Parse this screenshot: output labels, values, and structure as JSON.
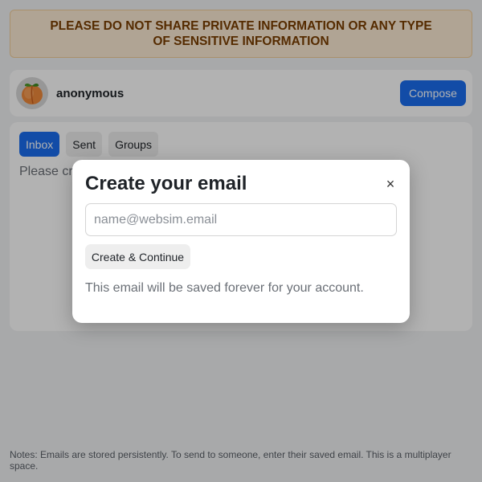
{
  "banner": {
    "text": "PLEASE DO NOT SHARE PRIVATE INFORMATION OR ANY TYPE OF SENSITIVE INFORMATION"
  },
  "profile": {
    "avatar_icon": "peach-icon",
    "username": "anonymous",
    "compose_label": "Compose"
  },
  "tabs": [
    {
      "label": "Inbox",
      "active": true
    },
    {
      "label": "Sent",
      "active": false
    },
    {
      "label": "Groups",
      "active": false
    }
  ],
  "panel": {
    "text": "Please cr"
  },
  "footer": {
    "note": "Notes: Emails are stored persistently. To send to someone, enter their saved email. This is a multiplayer space."
  },
  "modal": {
    "title": "Create your email",
    "close_icon": "close-icon",
    "close_glyph": "×",
    "email_placeholder": "name@websim.email",
    "create_label": "Create & Continue",
    "hint": "This email will be saved forever for your account."
  },
  "colors": {
    "accent": "#1a6ef0",
    "banner_bg": "#fdebd5",
    "banner_text": "#7a3e00"
  }
}
